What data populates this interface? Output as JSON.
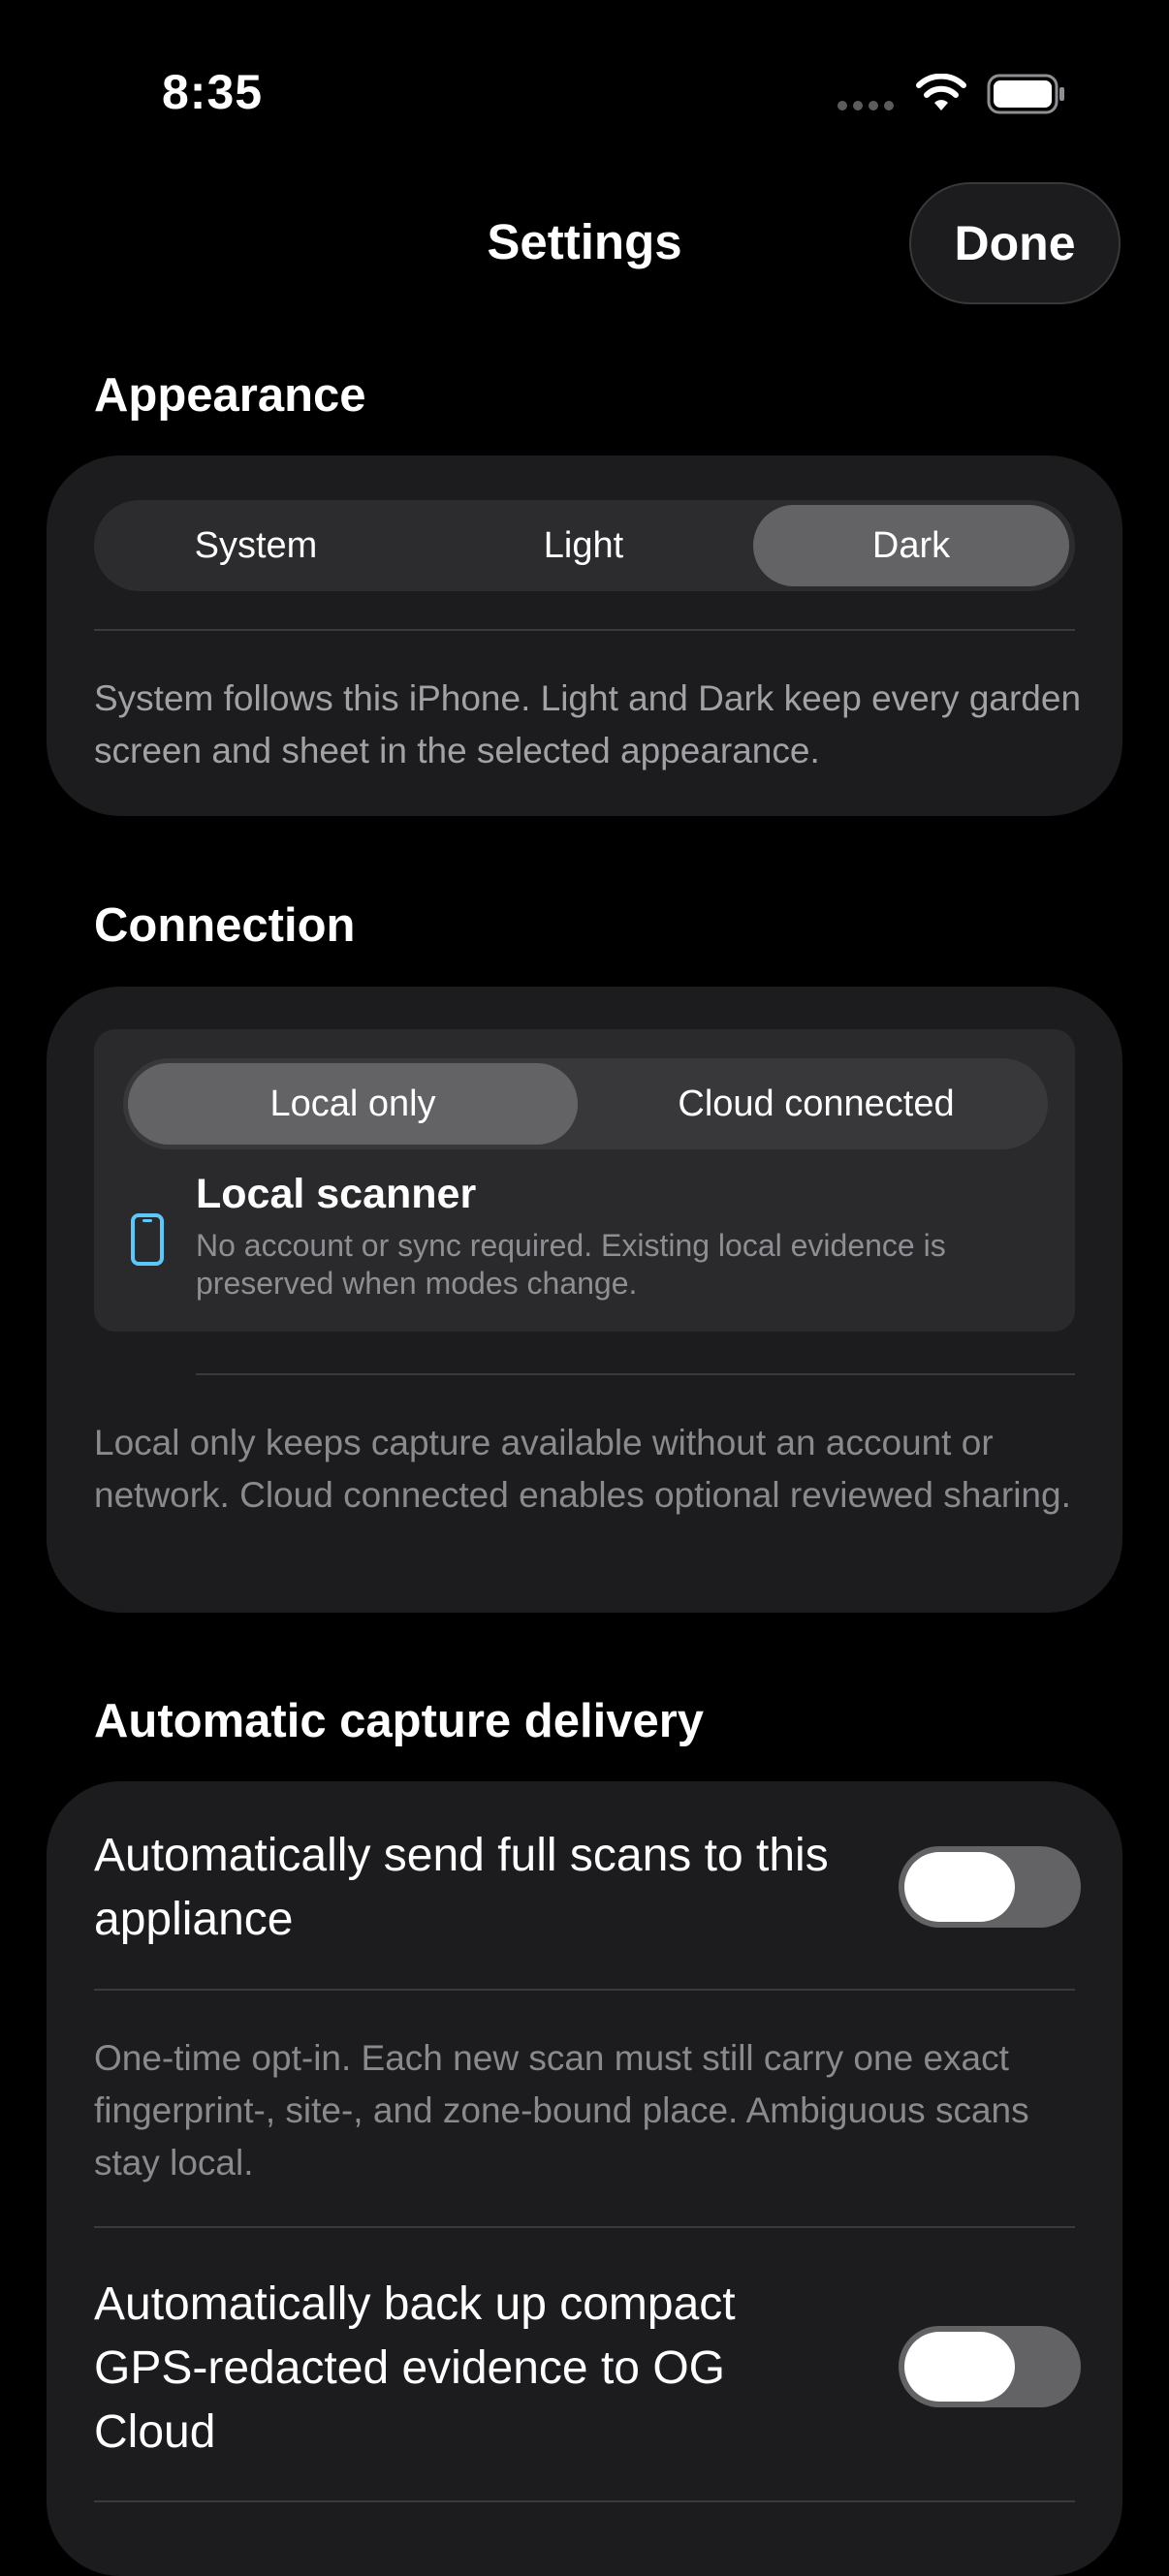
{
  "status_bar": {
    "time": "8:35"
  },
  "nav": {
    "title": "Settings",
    "done_label": "Done"
  },
  "appearance": {
    "header": "Appearance",
    "options": [
      "System",
      "Light",
      "Dark"
    ],
    "selected": "Dark",
    "footnote": "System follows this iPhone. Light and Dark keep every garden screen and sheet in the selected appearance."
  },
  "connection": {
    "header": "Connection",
    "options": [
      "Local only",
      "Cloud connected"
    ],
    "selected": "Local only",
    "scanner_title": "Local scanner",
    "scanner_desc": "No account or sync required. Existing local evidence is preserved when modes change.",
    "scanner_icon": "iphone-icon",
    "footnote": "Local only keeps capture available without an account or network. Cloud connected enables optional reviewed sharing."
  },
  "delivery": {
    "header": "Automatic capture delivery",
    "send_full_scans": {
      "label": "Automatically send full scans to this appliance",
      "on": false,
      "footnote": "One-time opt-in. Each new scan must still carry one exact fingerprint-, site-, and zone-bound place. Ambiguous scans stay local."
    },
    "backup_evidence": {
      "label": "Automatically back up compact GPS-redacted evidence to OG Cloud",
      "on": false
    }
  },
  "colors": {
    "background": "#000000",
    "card": "#1c1c1e",
    "segment_track": "#2c2c2e",
    "segment_selected": "#636366",
    "accent_icon": "#5ac8fa"
  }
}
